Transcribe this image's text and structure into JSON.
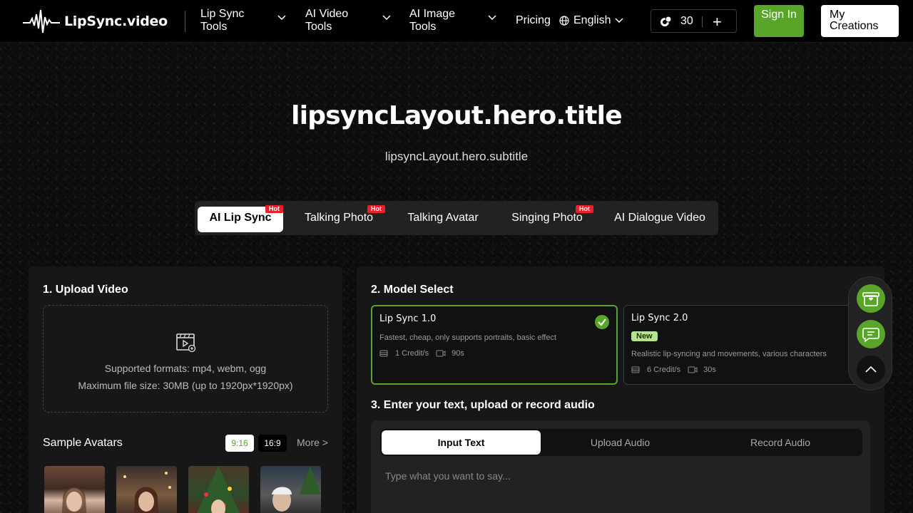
{
  "header": {
    "logo_text": "LipSync.video",
    "nav": [
      {
        "label": "Lip Sync\nTools"
      },
      {
        "label": "AI Video\nTools"
      },
      {
        "label": "AI Image\nTools"
      }
    ],
    "pricing": "Pricing",
    "language": "English",
    "credits": "30",
    "sign_in": "Sign In",
    "my_creations": "My Creations"
  },
  "hero": {
    "title": "lipsyncLayout.hero.title",
    "subtitle": "lipsyncLayout.hero.subtitle"
  },
  "tabs": [
    {
      "label": "AI Lip Sync",
      "hot": "Hot"
    },
    {
      "label": "Talking Photo",
      "hot": "Hot"
    },
    {
      "label": "Talking Avatar"
    },
    {
      "label": "Singing Photo",
      "hot": "Hot"
    },
    {
      "label": "AI Dialogue Video"
    }
  ],
  "upload": {
    "title": "1. Upload Video",
    "formats": "Supported formats: mp4, webm, ogg",
    "max_size": "Maximum file size: 30MB (up to 1920px*1920px)"
  },
  "samples": {
    "title": "Sample Avatars",
    "ratio_a": "9:16",
    "ratio_b": "16:9",
    "more": "More >"
  },
  "model": {
    "title": "2. Model Select",
    "cards": [
      {
        "name": "Lip Sync 1.0",
        "desc": "Fastest, cheap, only supports portraits, basic effect",
        "credits": "1 Credit/s",
        "duration": "90s"
      },
      {
        "name": "Lip Sync 2.0",
        "badge": "New",
        "desc": "Realistic lip-syncing and movements, various characters",
        "credits": "6 Credit/s",
        "duration": "30s"
      }
    ]
  },
  "audio": {
    "title": "3. Enter your text, upload or record audio",
    "tabs": [
      "Input Text",
      "Upload Audio",
      "Record Audio"
    ],
    "placeholder": "Type what you want to say..."
  },
  "colors": {
    "accent": "#59a52a",
    "hot": "#e8202a",
    "new_badge": "#b6e48c"
  }
}
